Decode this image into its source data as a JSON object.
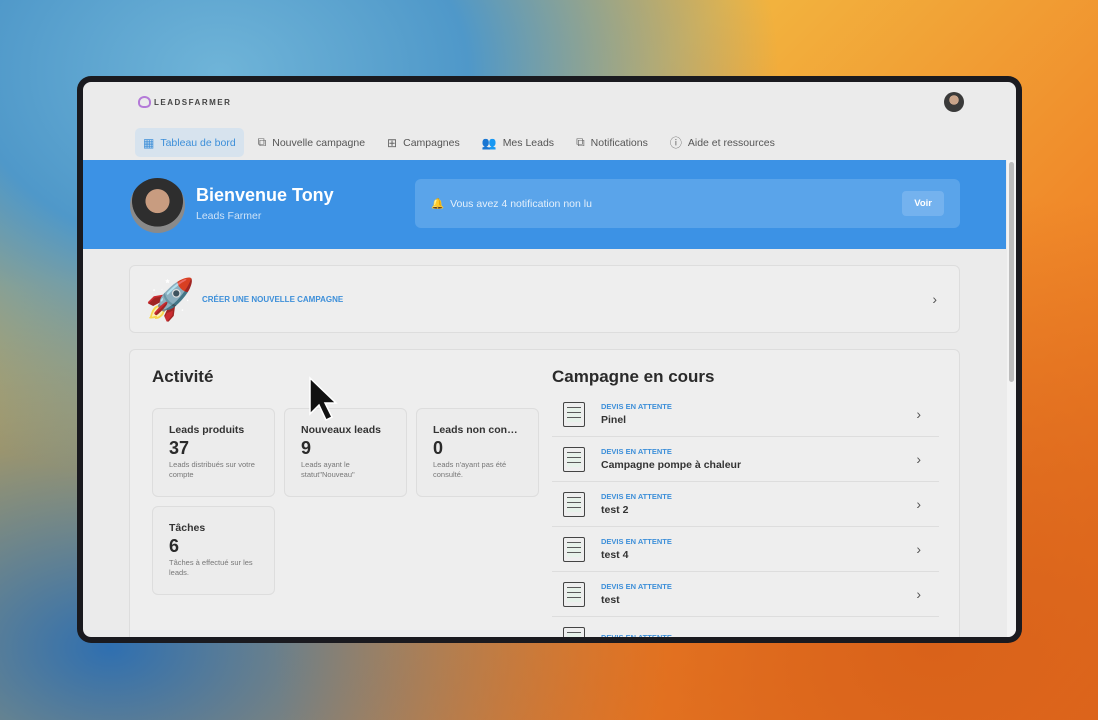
{
  "brand": "LEADSFARMER",
  "nav": [
    {
      "label": "Tableau de bord",
      "icon": "grid-icon",
      "active": true
    },
    {
      "label": "Nouvelle campagne",
      "icon": "new-campaign-icon"
    },
    {
      "label": "Campagnes",
      "icon": "table-icon"
    },
    {
      "label": "Mes Leads",
      "icon": "users-icon"
    },
    {
      "label": "Notifications",
      "icon": "notification-icon"
    },
    {
      "label": "Aide et ressources",
      "icon": "help-icon"
    }
  ],
  "banner": {
    "title": "Bienvenue Tony",
    "subtitle": "Leads Farmer",
    "notification": "Vous avez 4 notification non lu",
    "button": "Voir"
  },
  "create": {
    "label": "CRÉER UNE NOUVELLE CAMPAGNE"
  },
  "activity": {
    "title": "Activité",
    "cards": [
      {
        "title": "Leads produits",
        "value": "37",
        "desc": "Leads distribués sur votre compte"
      },
      {
        "title": "Nouveaux leads",
        "value": "9",
        "desc": "Leads ayant le statut\"Nouveau\""
      },
      {
        "title": "Leads non consultés",
        "value": "0",
        "desc": "Leads n'ayant pas été consulté."
      },
      {
        "title": "Tâches",
        "value": "6",
        "desc": "Tâches à effectué sur les leads."
      }
    ]
  },
  "campaigns": {
    "title": "Campagne en cours",
    "items": [
      {
        "status": "DEVIS EN ATTENTE",
        "name": "Pinel"
      },
      {
        "status": "DEVIS EN ATTENTE",
        "name": "Campagne pompe à chaleur"
      },
      {
        "status": "DEVIS EN ATTENTE",
        "name": "test 2"
      },
      {
        "status": "DEVIS EN ATTENTE",
        "name": "test 4"
      },
      {
        "status": "DEVIS EN ATTENTE",
        "name": "test"
      },
      {
        "status": "DEVIS EN ATTENTE",
        "name": ""
      }
    ]
  },
  "colors": {
    "accent": "#3c92e5",
    "link": "#3d8fd9"
  }
}
